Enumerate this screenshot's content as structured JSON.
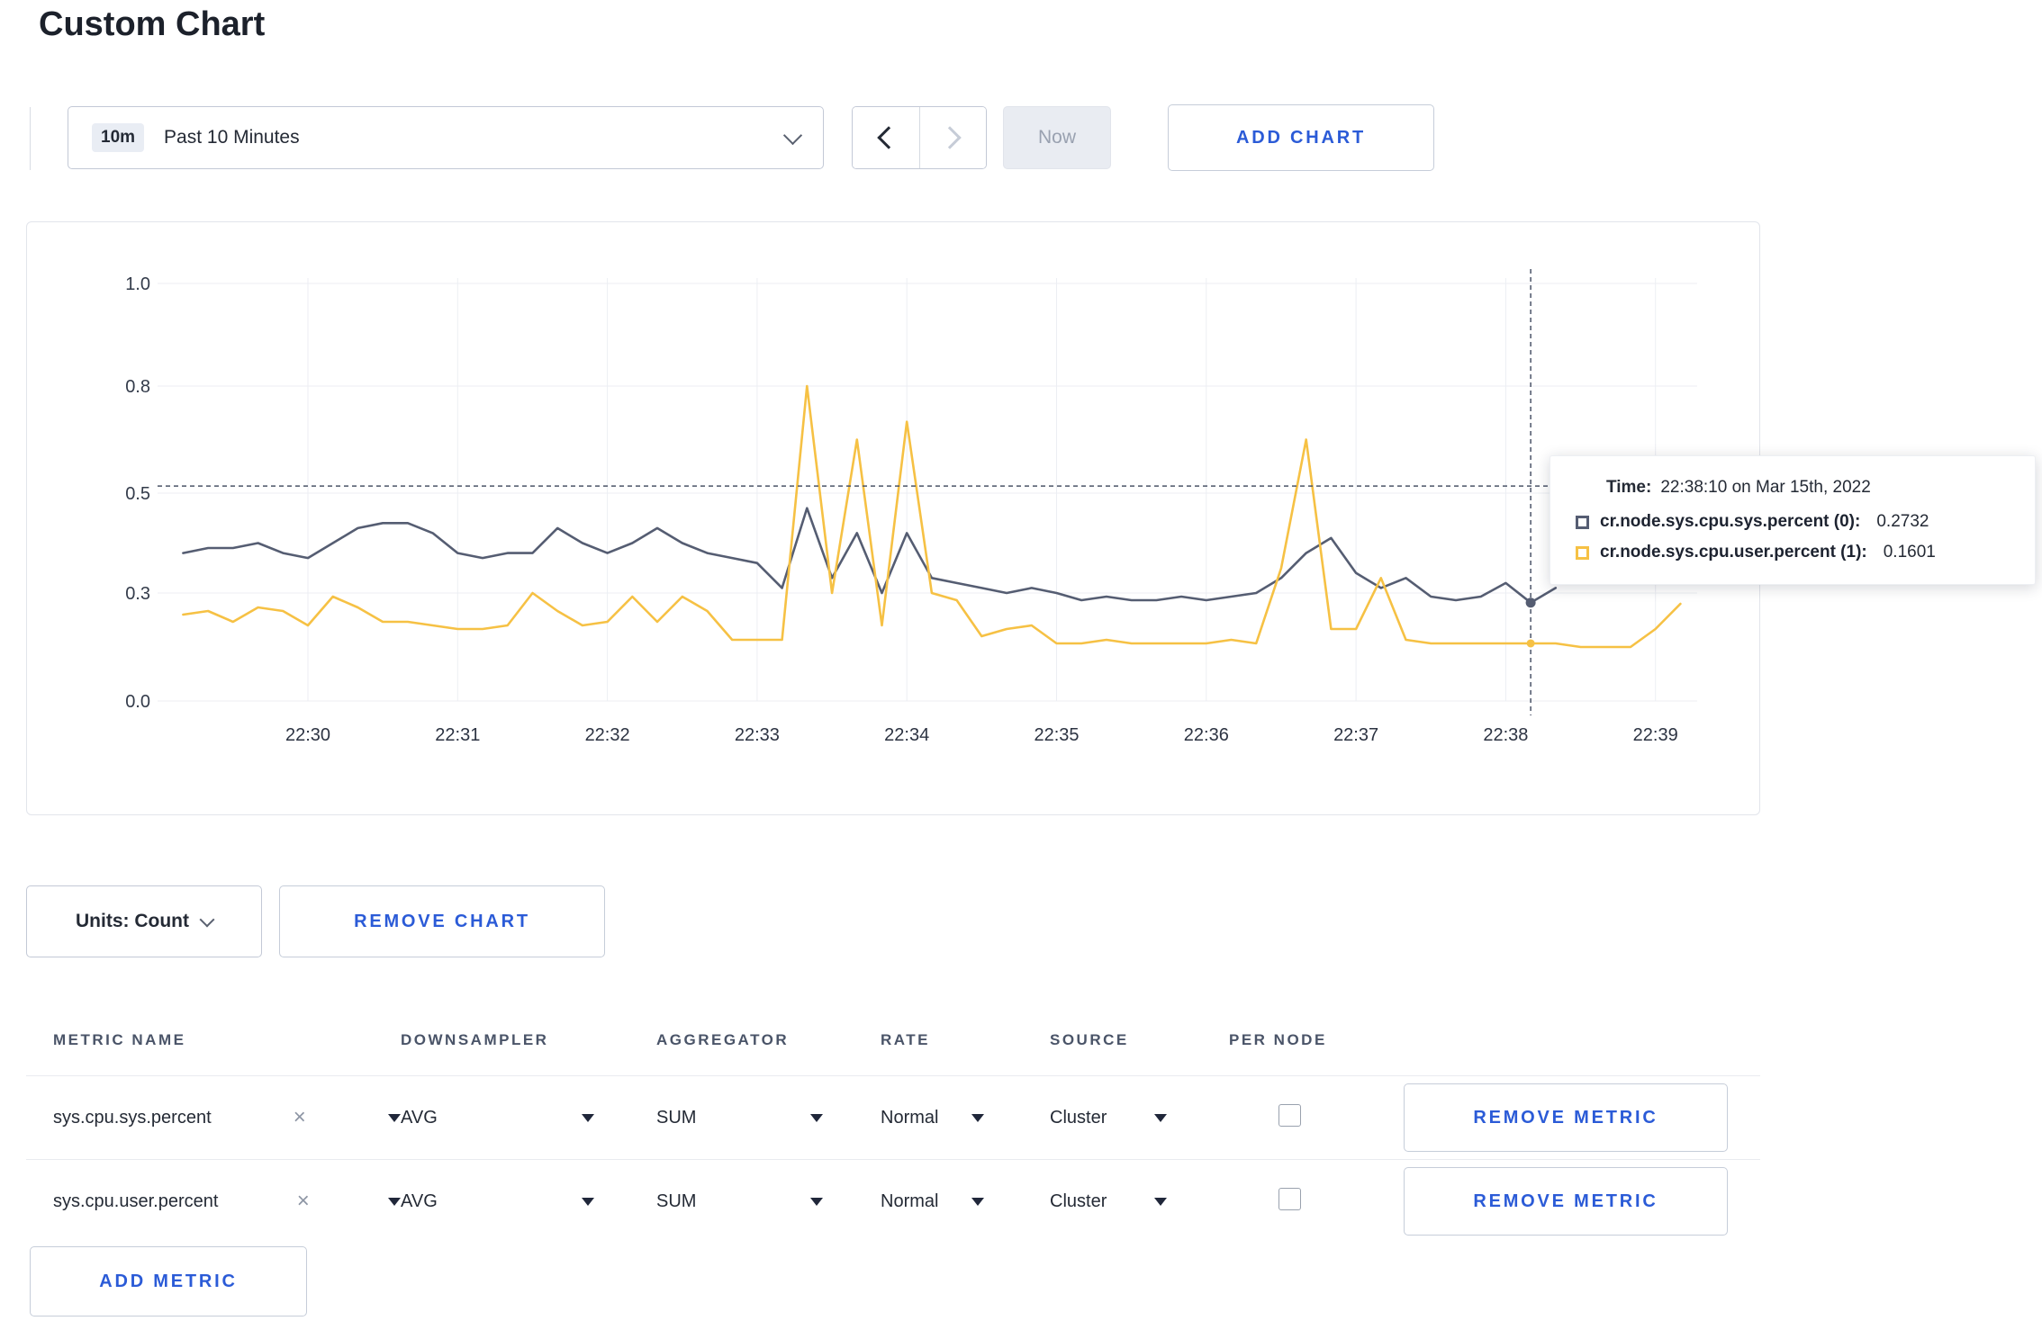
{
  "page": {
    "title": "Custom Chart"
  },
  "toolbar": {
    "time_range_badge": "10m",
    "time_range_label": "Past 10 Minutes",
    "now_label": "Now",
    "add_chart_label": "ADD CHART"
  },
  "chart_controls": {
    "units_label": "Units: Count",
    "remove_chart_label": "REMOVE CHART"
  },
  "icons": {
    "clear_metric": "×"
  },
  "metrics_table": {
    "headers": [
      "METRIC NAME",
      "DOWNSAMPLER",
      "AGGREGATOR",
      "RATE",
      "SOURCE",
      "PER NODE"
    ],
    "rows": [
      {
        "metric": "sys.cpu.sys.percent",
        "downsampler": "AVG",
        "aggregator": "SUM",
        "rate": "Normal",
        "source": "Cluster",
        "per_node_checked": false,
        "remove_label": "REMOVE METRIC"
      },
      {
        "metric": "sys.cpu.user.percent",
        "downsampler": "AVG",
        "aggregator": "SUM",
        "rate": "Normal",
        "source": "Cluster",
        "per_node_checked": false,
        "remove_label": "REMOVE METRIC"
      }
    ],
    "add_metric_label": "ADD METRIC"
  },
  "chart_data": {
    "type": "line",
    "title": "",
    "y_ticks": [
      "0.0",
      "0.3",
      "0.5",
      "0.8",
      "1.0"
    ],
    "y_tick_values": [
      0,
      0.3,
      0.5,
      0.8,
      1.0
    ],
    "x_tick_labels": [
      "22:30",
      "22:31",
      "22:32",
      "22:33",
      "22:34",
      "22:35",
      "22:36",
      "22:37",
      "22:38",
      "22:39"
    ],
    "start_time": "22:29:10",
    "interval_seconds": 10,
    "series": [
      {
        "name": "cr.node.sys.cpu.sys.percent",
        "color": "#555d72",
        "values": [
          0.38,
          0.39,
          0.39,
          0.4,
          0.38,
          0.37,
          0.4,
          0.43,
          0.44,
          0.44,
          0.42,
          0.38,
          0.37,
          0.38,
          0.38,
          0.43,
          0.4,
          0.38,
          0.4,
          0.43,
          0.4,
          0.38,
          0.37,
          0.36,
          0.31,
          0.47,
          0.33,
          0.42,
          0.3,
          0.42,
          0.33,
          0.32,
          0.31,
          0.3,
          0.31,
          0.3,
          0.28,
          0.29,
          0.28,
          0.28,
          0.29,
          0.28,
          0.29,
          0.3,
          0.33,
          0.38,
          0.41,
          0.34,
          0.31,
          0.33,
          0.29,
          0.28,
          0.29,
          0.32,
          0.2732,
          0.31
        ]
      },
      {
        "name": "cr.node.sys.cpu.user.percent",
        "color": "#f6c144",
        "values": [
          0.24,
          0.25,
          0.22,
          0.26,
          0.25,
          0.21,
          0.29,
          0.26,
          0.22,
          0.22,
          0.21,
          0.2,
          0.2,
          0.21,
          0.3,
          0.25,
          0.21,
          0.22,
          0.29,
          0.22,
          0.29,
          0.25,
          0.17,
          0.17,
          0.17,
          0.8,
          0.3,
          0.65,
          0.21,
          0.7,
          0.3,
          0.28,
          0.18,
          0.2,
          0.21,
          0.16,
          0.16,
          0.17,
          0.16,
          0.16,
          0.16,
          0.16,
          0.17,
          0.16,
          0.35,
          0.65,
          0.2,
          0.2,
          0.33,
          0.17,
          0.16,
          0.16,
          0.16,
          0.16,
          0.1601,
          0.16,
          0.15,
          0.15,
          0.15,
          0.2,
          0.27
        ]
      }
    ],
    "crosshair": {
      "time": "22:38:10",
      "hline_value": 0.52
    },
    "tooltip": {
      "time_label": "Time:",
      "time_value": "22:38:10 on Mar 15th, 2022",
      "entries": [
        {
          "label": "cr.node.sys.cpu.sys.percent (0):",
          "value": "0.2732",
          "color": "#555d72"
        },
        {
          "label": "cr.node.sys.cpu.user.percent (1):",
          "value": "0.1601",
          "color": "#f6c144"
        }
      ]
    }
  }
}
